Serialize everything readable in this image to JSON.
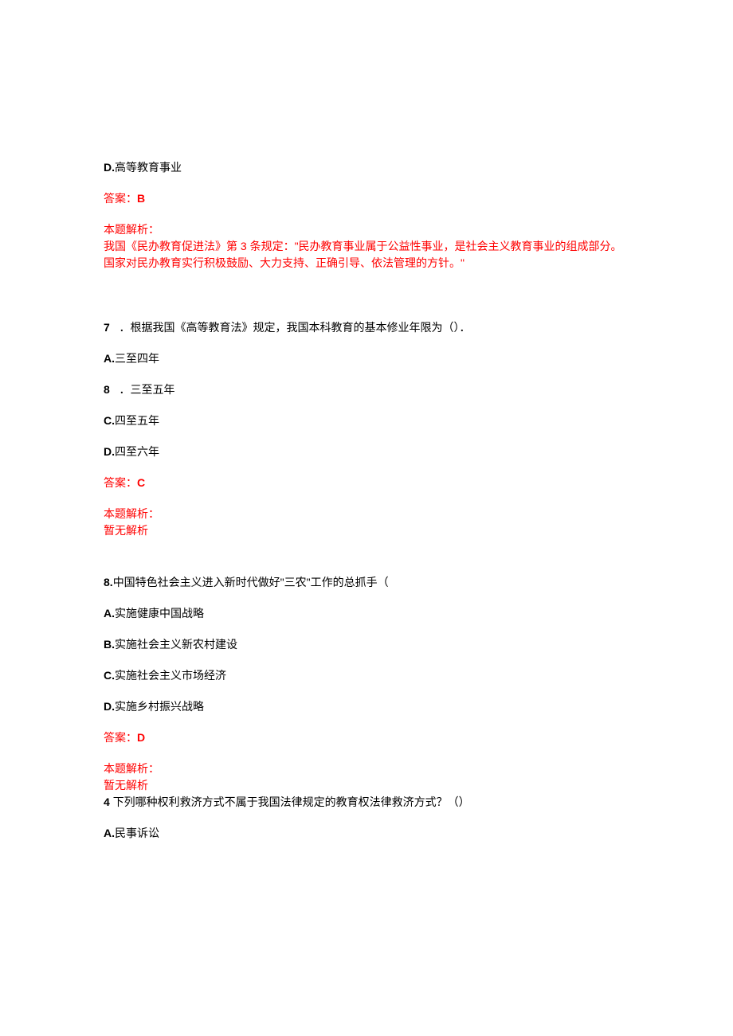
{
  "q6": {
    "optionD_prefix": "D.",
    "optionD_text": "高等教育事业",
    "answer_label": "答案：",
    "answer_value": "B",
    "explain_label": "本题解析：",
    "explain_text": "我国《民办教育促进法》第 3 条规定：\"民办教育事业属于公益性事业，是社会主义教育事业的组成部分。国家对民办教育实行积极鼓励、大力支持、正确引导、依法管理的方针。\""
  },
  "q7": {
    "number": "7",
    "stem": "．根据我国《高等教育法》规定，我国本科教育的基本修业年限为（）．",
    "optA_prefix": "A.",
    "optA_text": "三至四年",
    "optB_prefix": "8",
    "optB_text": "．三至五年",
    "optC_prefix": "C.",
    "optC_text": "四至五年",
    "optD_prefix": "D.",
    "optD_text": "四至六年",
    "answer_label": "答案：",
    "answer_value": "C",
    "explain_label": "本题解析：",
    "explain_text": "暂无解析"
  },
  "q8": {
    "number": "8.",
    "stem": "中国特色社会主义进入新时代做好\"三农\"工作的总抓手（",
    "optA_prefix": "A.",
    "optA_text": "实施健康中国战略",
    "optB_prefix": "B.",
    "optB_text": "实施社会主义新农村建设",
    "optC_prefix": "C.",
    "optC_text": "实施社会主义市场经济",
    "optD_prefix": "D.",
    "optD_text": "实施乡村振兴战略",
    "answer_label": "答案：",
    "answer_value": "D",
    "explain_label": "本题解析：",
    "explain_text": "暂无解析"
  },
  "q9": {
    "number": "4 ",
    "stem": "下列哪种权利救济方式不属于我国法律规定的教育权法律救济方式？（）",
    "optA_prefix": "A.",
    "optA_text": "民事诉讼"
  }
}
